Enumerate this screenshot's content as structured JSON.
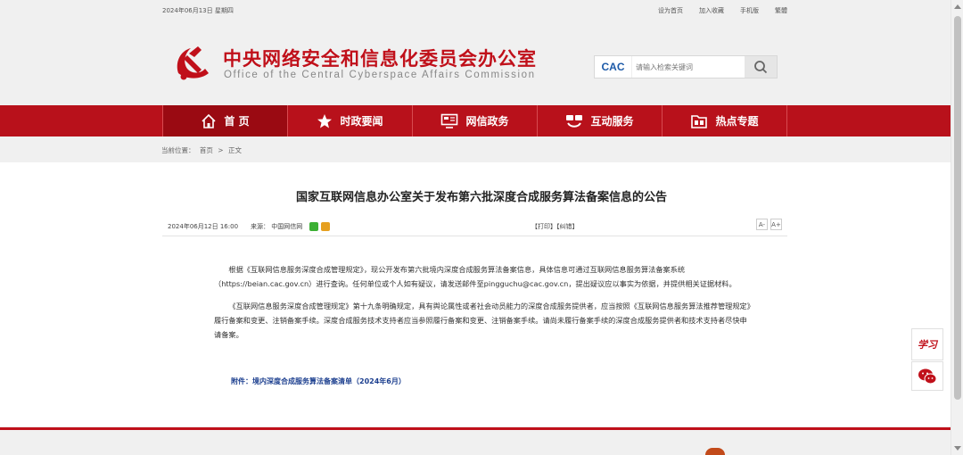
{
  "topbar": {
    "date": "2024年06月13日 星期四",
    "links": [
      "设为首页",
      "加入收藏",
      "手机版",
      "繁體"
    ]
  },
  "header": {
    "title": "中央网络安全和信息化委员会办公室",
    "subtitle": "Office of the Central Cyberspace Affairs Commission",
    "logo_text": "CAC",
    "search_placeholder": "请输入检索关键词"
  },
  "nav": {
    "items": [
      {
        "label": "首  页",
        "icon": "home-icon"
      },
      {
        "label": "时政要闻",
        "icon": "star-icon"
      },
      {
        "label": "网信政务",
        "icon": "monitor-icon"
      },
      {
        "label": "互动服务",
        "icon": "handshake-icon"
      },
      {
        "label": "热点专题",
        "icon": "folder-icon"
      }
    ]
  },
  "breadcrumb": {
    "prefix": "当前位置：",
    "home": "首页",
    "sep": ">",
    "current": "正文"
  },
  "article": {
    "title": "国家互联网信息办公室关于发布第六批深度合成服务算法备案信息的公告",
    "date": "2024年06月12日 16:00",
    "source": "来源：  中国网信网",
    "print": "【打印】【纠错】",
    "font_small": "A-",
    "font_large": "A+",
    "paragraphs": [
      "根据《互联网信息服务深度合成管理规定》，现公开发布第六批境内深度合成服务算法备案信息，具体信息可通过互联网信息服务算法备案系统（https://beian.cac.gov.cn）进行查询。任何单位或个人如有疑议，请发送邮件至pingguchu@cac.gov.cn，提出疑议应以事实为依据，并提供相关证据材料。",
      "《互联网信息服务深度合成管理规定》第十九条明确规定，具有舆论属性或者社会动员能力的深度合成服务提供者，应当按照《互联网信息服务算法推荐管理规定》履行备案和变更、注销备案手续。深度合成服务技术支持者应当参照履行备案和变更、注销备案手续。请尚未履行备案手续的深度合成服务提供者和技术支持者尽快申请备案。"
    ],
    "attachment": "附件：境内深度合成服务算法备案清单（2024年6月）"
  },
  "float": {
    "study": "学习",
    "wechat": "wechat-icon"
  },
  "colors": {
    "brand_red": "#b8111b",
    "title_red": "#c0101a",
    "link_blue": "#1c3f8f"
  }
}
